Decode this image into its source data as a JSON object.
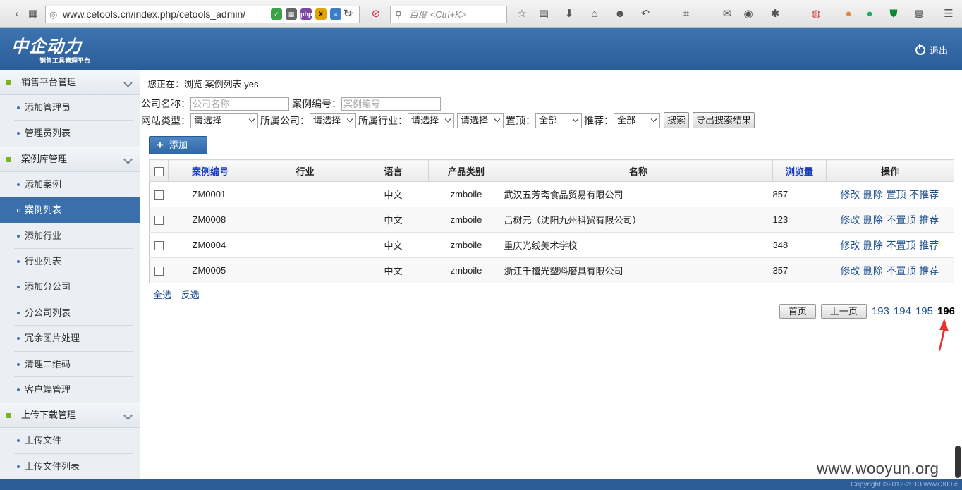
{
  "browser": {
    "url": "www.cetools.cn/index.php/cetools_admin/",
    "search_placeholder": "百度 <Ctrl+K>"
  },
  "header": {
    "logo_text": "中企动力",
    "logo_sub": "销售工具管理平台",
    "logout_label": "退出"
  },
  "sidebar": {
    "groups": [
      {
        "label": "销售平台管理",
        "items": [
          "添加管理员",
          "管理员列表"
        ]
      },
      {
        "label": "案例库管理",
        "items": [
          "添加案例",
          "案例列表",
          "添加行业",
          "行业列表",
          "添加分公司",
          "分公司列表",
          "冗余图片处理",
          "清理二维码",
          "客户端管理"
        ]
      },
      {
        "label": "上传下载管理",
        "items": [
          "上传文件",
          "上传文件列表"
        ]
      }
    ]
  },
  "breadcrumb": "您正在：浏览 案例列表 yes",
  "filters": {
    "company_label": "公司名称：",
    "company_placeholder": "公司名称",
    "case_no_label": "案例编号：",
    "case_no_placeholder": "案例编号",
    "site_type_label": "网站类型：",
    "site_type_value": "请选择",
    "branch_label": "所属公司：",
    "branch_value": "请选择",
    "industry_label": "所属行业：",
    "industry_value": "请选择",
    "industry_sub_value": "请选择",
    "top_label": "置顶：",
    "top_value": "全部",
    "recommend_label": "推荐：",
    "recommend_value": "全部",
    "search_button": "搜索",
    "export_button": "导出搜索结果"
  },
  "add_button": "添加",
  "table": {
    "headers": [
      "案例编号",
      "行业",
      "语言",
      "产品类别",
      "名称",
      "浏览量",
      "操作"
    ],
    "rows": [
      {
        "id": "ZM0001",
        "industry": "",
        "lang": "中文",
        "category": "zmboile",
        "name": "武汉五芳斋食品贸易有限公司",
        "views": "857",
        "ops": [
          "修改",
          "删除",
          "置顶",
          "不推荐"
        ]
      },
      {
        "id": "ZM0008",
        "industry": "",
        "lang": "中文",
        "category": "zmboile",
        "name": "吕树元（沈阳九州科贸有限公司）",
        "views": "123",
        "ops": [
          "修改",
          "删除",
          "不置顶",
          "推荐"
        ]
      },
      {
        "id": "ZM0004",
        "industry": "",
        "lang": "中文",
        "category": "zmboile",
        "name": "重庆光线美术学校",
        "views": "348",
        "ops": [
          "修改",
          "删除",
          "不置顶",
          "推荐"
        ]
      },
      {
        "id": "ZM0005",
        "industry": "",
        "lang": "中文",
        "category": "zmboile",
        "name": "浙江千禧光塑料磨具有限公司",
        "views": "357",
        "ops": [
          "修改",
          "删除",
          "不置顶",
          "推荐"
        ]
      }
    ]
  },
  "selection": {
    "select_all": "全选",
    "invert": "反选"
  },
  "pagination": {
    "first": "首页",
    "prev": "上一页",
    "pages": [
      "193",
      "194",
      "195"
    ],
    "current": "196"
  },
  "watermark": "www.wooyun.org",
  "footer": {
    "copyright": "Copyright ©2012-2013 www.300.c"
  }
}
